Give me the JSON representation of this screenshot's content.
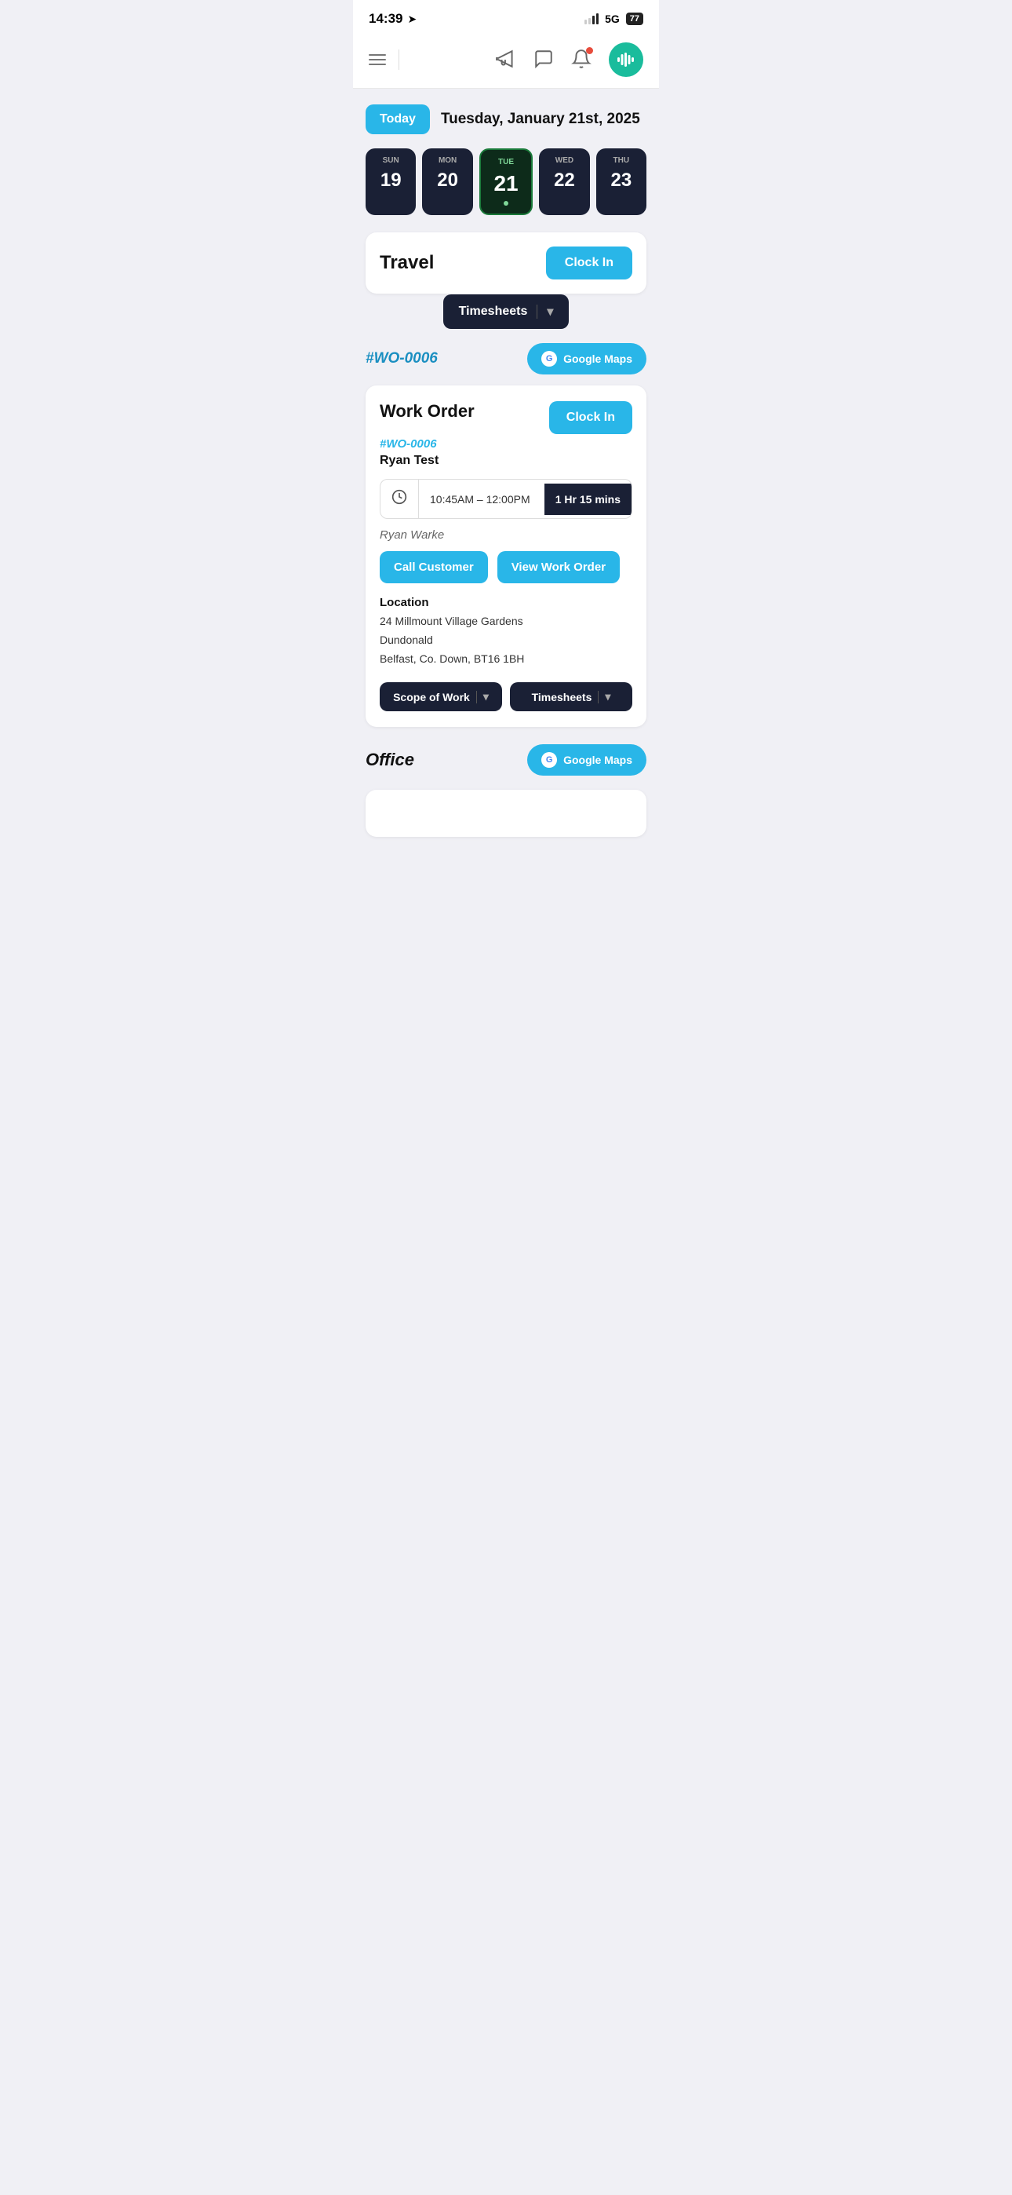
{
  "status_bar": {
    "time": "14:39",
    "signal_label": "5G",
    "battery": "77"
  },
  "nav": {
    "menu_label": "☰",
    "icons": {
      "announce": "📢",
      "chat": "💬",
      "bell": "🔔"
    },
    "avatar_initials": "≡≡"
  },
  "header": {
    "today_label": "Today",
    "date": "Tuesday, January 21st, 2025"
  },
  "calendar": {
    "days": [
      {
        "name": "SUN",
        "num": "19",
        "selected": false
      },
      {
        "name": "MON",
        "num": "20",
        "selected": false
      },
      {
        "name": "TUE",
        "num": "21",
        "selected": true
      },
      {
        "name": "WED",
        "num": "22",
        "selected": false
      },
      {
        "name": "THU",
        "num": "23",
        "selected": false
      }
    ]
  },
  "travel_card": {
    "title": "Travel",
    "clock_in_label": "Clock In"
  },
  "timesheets_dropdown": {
    "label": "Timesheets",
    "arrow": "▾"
  },
  "wo_header": {
    "number": "#WO-0006",
    "google_maps_label": "Google Maps"
  },
  "work_order_card": {
    "title": "Work Order",
    "number": "#WO-0006",
    "customer_name": "Ryan Test",
    "time_range": "10:45AM – 12:00PM",
    "duration": "1 Hr 15 mins",
    "technician": "Ryan Warke",
    "clock_in_label": "Clock In",
    "call_customer_label": "Call Customer",
    "view_work_order_label": "View Work Order",
    "location_label": "Location",
    "location_line1": "24 Millmount Village Gardens",
    "location_line2": "Dundonald",
    "location_line3": "Belfast, Co. Down, BT16 1BH",
    "scope_of_work_label": "Scope of Work",
    "timesheets_label": "Timesheets"
  },
  "office_section": {
    "label": "Office",
    "google_maps_label": "Google Maps"
  }
}
